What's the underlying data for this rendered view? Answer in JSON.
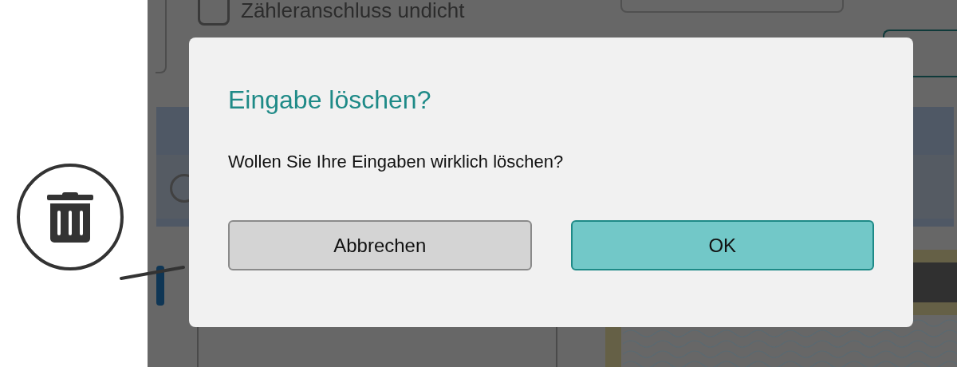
{
  "background": {
    "checkbox": {
      "label": "Zähleranschluss undicht",
      "checked": false
    }
  },
  "dialog": {
    "title": "Eingabe löschen?",
    "message": "Wollen Sie Ihre Eingaben wirklich löschen?",
    "buttons": [
      {
        "label": "Abbrechen",
        "kind": "secondary"
      },
      {
        "label": "OK",
        "kind": "primary"
      }
    ]
  }
}
